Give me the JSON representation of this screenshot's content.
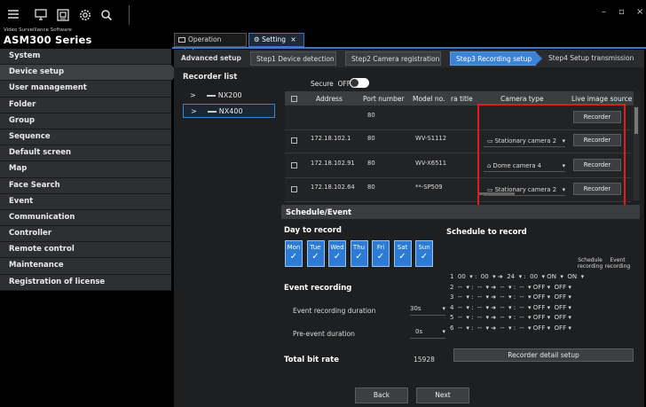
{
  "app": {
    "brand_small": "Video Surveillance Software",
    "brand_big": "ASM300 Series"
  },
  "top_icons": [
    "menu-icon",
    "monitor-icon",
    "camera-view-icon",
    "gear-icon",
    "search-icon"
  ],
  "window_controls": {
    "minimize": "–",
    "maximize": "▫",
    "close": "×"
  },
  "tabs": [
    {
      "label": "Operation window",
      "icon": "operation-window-icon"
    },
    {
      "label": "Setting",
      "icon": "gear-icon",
      "close": "×"
    }
  ],
  "sidebar": {
    "items": [
      "System",
      "Device setup",
      "User management",
      "Folder",
      "Group",
      "Sequence",
      "Default screen",
      "Map",
      "Face Search",
      "Event",
      "Communication",
      "Controller",
      "Remote control",
      "Maintenance",
      "Registration of license"
    ],
    "active_index": 1
  },
  "subnav": {
    "advanced": "Advanced setup",
    "steps": [
      "Step1 Device detection",
      "Step2 Camera registration",
      "Step3 Recording setup",
      "Step4 Setup transmission"
    ],
    "current_step": 2
  },
  "recorder_list": {
    "title": "Recorder list",
    "items": [
      {
        "name": "NX200",
        "expander": ">"
      },
      {
        "name": "NX400",
        "expander": ">"
      }
    ],
    "selected_index": 1
  },
  "secure": {
    "label": "Secure",
    "state": "OFF"
  },
  "table": {
    "headers": [
      "Address",
      "Port number",
      "Model no.",
      "ra title",
      "Camera type",
      "Live image source"
    ],
    "rows": [
      {
        "address": "",
        "port": "80",
        "model": "",
        "camera_type": "",
        "camera_icon": "",
        "source": "Recorder",
        "has_checkbox": false
      },
      {
        "address": "172.18.102.1",
        "port": "80",
        "model": "WV-S1112",
        "camera_type": "Stationary camera 2",
        "camera_icon": "bullet-camera-icon",
        "source": "Recorder",
        "has_checkbox": true
      },
      {
        "address": "172.18.102.91",
        "port": "80",
        "model": "WV-X6511",
        "camera_type": "Dome camera 4",
        "camera_icon": "dome-camera-icon",
        "source": "Recorder",
        "has_checkbox": true
      },
      {
        "address": "172.18.102.64",
        "port": "80",
        "model": "**-SP509",
        "camera_type": "Stationary camera 2",
        "camera_icon": "bullet-camera-icon",
        "source": "Recorder",
        "has_checkbox": true
      }
    ]
  },
  "schedule": {
    "section_title": "Schedule/Event",
    "day_title": "Day to record",
    "days": [
      "Mon",
      "Tue",
      "Wed",
      "Thu",
      "Fri",
      "Sat",
      "Sun"
    ],
    "sched_title": "Schedule to record",
    "col_schedule": "Schedule recording",
    "col_event": "Event recording",
    "lines": [
      "1  00  ▾ :  00  ▾ ➜  24  ▾ :  00  ▾ ON  ▾  ON  ▾",
      "2  --  ▾ :  --  ▾ ➜  --  ▾ :  --  ▾ OFF ▾  OFF ▾",
      "3  --  ▾ :  --  ▾ ➜  --  ▾ :  --  ▾ OFF ▾  OFF ▾",
      "4  --  ▾ :  --  ▾ ➜  --  ▾ :  --  ▾ OFF ▾  OFF ▾",
      "5  --  ▾ :  --  ▾ ➜  --  ▾ :  --  ▾ OFF ▾  OFF ▾",
      "6  --  ▾ :  --  ▾ ➜  --  ▾ :  --  ▾ OFF ▾  OFF ▾"
    ],
    "event_recording": "Event recording",
    "event_duration_label": "Event recording duration",
    "event_duration_value": "30s",
    "pre_event_label": "Pre-event duration",
    "pre_event_value": "0s",
    "total_bitrate_label": "Total bit rate",
    "total_bitrate_value": "15928",
    "recorder_detail_button": "Recorder detail setup"
  },
  "footer": {
    "back": "Back",
    "next": "Next"
  },
  "colors": {
    "accent": "#3b83d6",
    "highlight_box": "#e01c1c",
    "sidebar_bg": "#2d2f33"
  }
}
